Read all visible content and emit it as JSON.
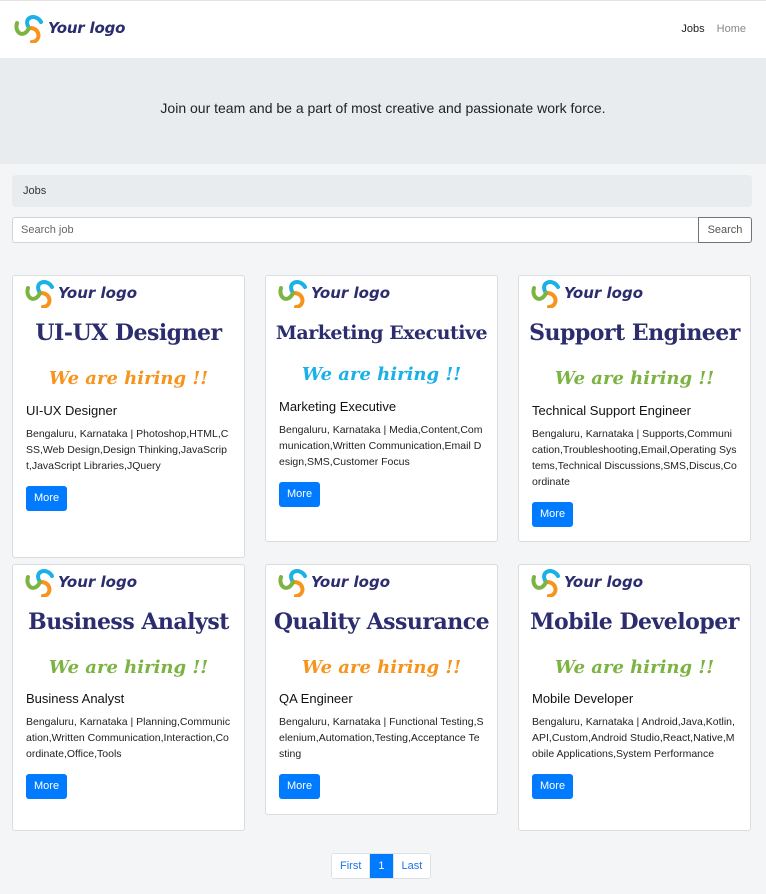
{
  "header": {
    "logo_text": "Your logo",
    "nav": [
      {
        "label": "Jobs",
        "active": true
      },
      {
        "label": "Home",
        "active": false
      }
    ]
  },
  "hero": {
    "text": "Join our team and be a part of most creative and passionate work force."
  },
  "breadcrumb": "Jobs",
  "search": {
    "placeholder": "Search job",
    "value": "",
    "button_label": "Search"
  },
  "jobs": [
    {
      "banner_logo": "Your logo",
      "banner_title": "UI-UX Designer",
      "banner_hiring": "We are hiring !!",
      "hiring_color": "#f7941d",
      "title": "UI-UX Designer",
      "description": "Bengaluru, Karnataka | Photoshop,HTML,CSS,Web Design,Design Thinking,JavaScript,JavaScript Libraries,JQuery",
      "button": "More"
    },
    {
      "banner_logo": "Your logo",
      "banner_title": "Marketing Executive",
      "banner_hiring": "We are hiring !!",
      "hiring_color": "#1ab0e8",
      "title": "Marketing Executive",
      "description": "Bengaluru, Karnataka | Media,Content,Communication,Written Communication,Email Design,SMS,Customer Focus",
      "button": "More"
    },
    {
      "banner_logo": "Your logo",
      "banner_title": "Support Engineer",
      "banner_hiring": "We are hiring !!",
      "hiring_color": "#7cb342",
      "title": "Technical Support Engineer",
      "description": "Bengaluru, Karnataka | Supports,Communication,Troubleshooting,Email,Operating Systems,Technical Discussions,SMS,Discus,Coordinate",
      "button": "More"
    },
    {
      "banner_logo": "Your logo",
      "banner_title": "Business Analyst",
      "banner_hiring": "We are hiring !!",
      "hiring_color": "#7cb342",
      "title": "Business Analyst",
      "description": "Bengaluru, Karnataka | Planning,Communication,Written Communication,Interaction,Coordinate,Office,Tools",
      "button": "More"
    },
    {
      "banner_logo": "Your logo",
      "banner_title": "Quality Assurance",
      "banner_hiring": "We are hiring !!",
      "hiring_color": "#f7941d",
      "title": "QA Engineer",
      "description": "Bengaluru, Karnataka | Functional Testing,Selenium,Automation,Testing,Acceptance Testing",
      "button": "More"
    },
    {
      "banner_logo": "Your logo",
      "banner_title": "Mobile Developer",
      "banner_hiring": "We are hiring !!",
      "hiring_color": "#7cb342",
      "title": "Mobile Developer",
      "description": "Bengaluru, Karnataka | Android,Java,Kotlin,API,Custom,Android Studio,React,Native,Mobile Applications,System Performance",
      "button": "More"
    }
  ],
  "pagination": {
    "first": "First",
    "current": "1",
    "last": "Last"
  },
  "colors": {
    "primary": "#007bff",
    "brand_navy": "#2b2d6e"
  }
}
